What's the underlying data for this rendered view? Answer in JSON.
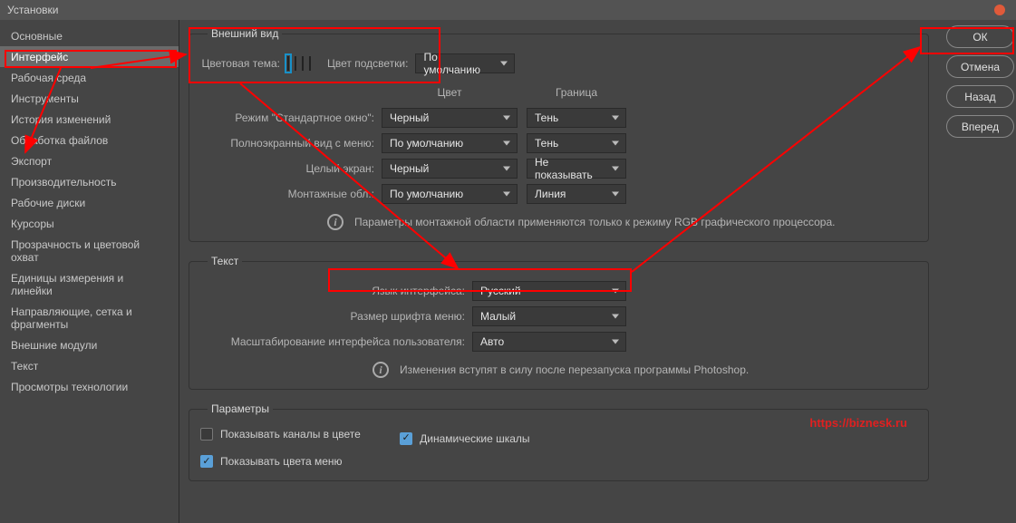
{
  "window": {
    "title": "Установки"
  },
  "sidebar": {
    "items": [
      "Основные",
      "Интерфейс",
      "Рабочая среда",
      "Инструменты",
      "История изменений",
      "Обработка файлов",
      "Экспорт",
      "Производительность",
      "Рабочие диски",
      "Курсоры",
      "Прозрачность и цветовой охват",
      "Единицы измерения и линейки",
      "Направляющие, сетка и фрагменты",
      "Внешние модули",
      "Текст",
      "Просмотры технологии"
    ],
    "selected_index": 1
  },
  "buttons": {
    "ok": "ОК",
    "cancel": "Отмена",
    "back": "Назад",
    "forward": "Вперед"
  },
  "appearance": {
    "legend": "Внешний вид",
    "color_theme_label": "Цветовая тема:",
    "swatches": [
      "#323232",
      "#535353",
      "#888888",
      "#d8d8d8"
    ],
    "swatch_selected": 0,
    "highlight_label": "Цвет подсветки:",
    "highlight_value": "По умолчанию",
    "headers": {
      "color": "Цвет",
      "border": "Граница"
    },
    "rows": [
      {
        "label": "Режим \"Стандартное окно\":",
        "color": "Черный",
        "border": "Тень"
      },
      {
        "label": "Полноэкранный вид с меню:",
        "color": "По умолчанию",
        "border": "Тень"
      },
      {
        "label": "Целый экран:",
        "color": "Черный",
        "border": "Не показывать"
      },
      {
        "label": "Монтажные обл.:",
        "color": "По умолчанию",
        "border": "Линия"
      }
    ],
    "info": "Параметры монтажной области применяются только к режиму RGB графического процессора."
  },
  "text": {
    "legend": "Текст",
    "lang_label": "Язык интерфейса:",
    "lang_value": "Русский",
    "font_label": "Размер шрифта меню:",
    "font_value": "Малый",
    "scale_label": "Масштабирование интерфейса пользователя:",
    "scale_value": "Авто",
    "info": "Изменения вступят в силу после перезапуска программы Photoshop."
  },
  "params": {
    "legend": "Параметры",
    "chk1": {
      "label": "Показывать каналы в цвете",
      "checked": false
    },
    "chk2": {
      "label": "Динамические шкалы",
      "checked": true
    },
    "chk3": {
      "label": "Показывать цвета меню",
      "checked": true
    }
  },
  "watermark": "https://biznesk.ru"
}
